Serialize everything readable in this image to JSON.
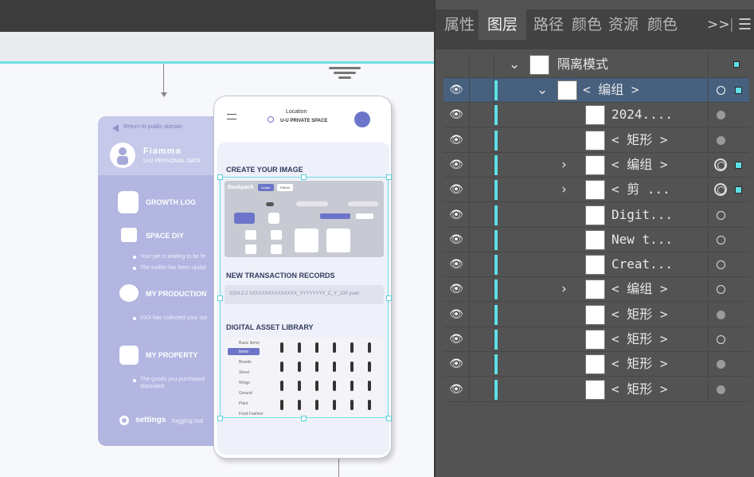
{
  "panel": {
    "tabs": [
      {
        "label": "属性",
        "active": false
      },
      {
        "label": "图层",
        "active": true
      },
      {
        "label": "路径",
        "active": false
      },
      {
        "label": "颜色",
        "active": false
      },
      {
        "label": "资源",
        "active": false
      },
      {
        "label": "颜色",
        "active": false
      }
    ],
    "more_label": ">>",
    "separator": "|",
    "menu_label": "☰",
    "isolation_label": "隔离模式",
    "layers": [
      {
        "name": "< 编组 >",
        "expanded": true,
        "selected": true,
        "target": "open-white"
      },
      {
        "name": "2024....",
        "target": "filled"
      },
      {
        "name": "< 矩形 >",
        "target": "filled"
      },
      {
        "name": "< 编组 >",
        "collapsed": true,
        "target": "double",
        "square": true
      },
      {
        "name": "< 剪 ...",
        "collapsed": true,
        "target": "double",
        "square": true
      },
      {
        "name": "Digit...",
        "target": "open"
      },
      {
        "name": "New t...",
        "target": "open"
      },
      {
        "name": "Creat...",
        "target": "open"
      },
      {
        "name": "< 编组 >",
        "collapsed": true,
        "target": "open"
      },
      {
        "name": "< 矩形 >",
        "target": "filled"
      },
      {
        "name": "< 矩形 >",
        "target": "open"
      },
      {
        "name": "< 矩形 >",
        "target": "filled"
      },
      {
        "name": "< 矩形 >",
        "target": "filled"
      }
    ],
    "accent_color": "#5ee0e6",
    "selected_row_color": "#46607e"
  },
  "left_card": {
    "return_text": "Return to public domain",
    "user_name": "Fiamma",
    "user_sub": "U-U  PERSONAL DATA",
    "items": [
      "GROWTH LOG",
      "SPACE DIY",
      "MY PRODUCTION",
      "MY PROPERTY"
    ],
    "space_notes": [
      "Your pet is waiting to be fe",
      "The toolkit has been updat"
    ],
    "production_note": "XXX has collected your not",
    "property_notes": [
      "The goods you purchased",
      "deposited"
    ],
    "settings": "settings",
    "logout": "logging out",
    "color": "#b3b6e0"
  },
  "phone": {
    "location_label": "Location",
    "space_label": "U-U  PRIVATE SPACE",
    "create_title": "CREATE YOUR IMAGE",
    "backpack_label": "Backpack",
    "chip_avatar": "Avatar",
    "chip_effects": "Effects",
    "txn_title": "NEW TRANSACTION RECORDS",
    "txn_row": "2024.2.2   XXXXXXXXXXXXXXX_YYYYYYYY_C_Y_100 yuan",
    "library_title": "DIGITAL ASSET LIBRARY",
    "library_items": [
      "Basic Items",
      "Items",
      "Boards",
      "Sheet",
      "Wings",
      "Ground",
      "Plant",
      "Food Fashion"
    ]
  }
}
